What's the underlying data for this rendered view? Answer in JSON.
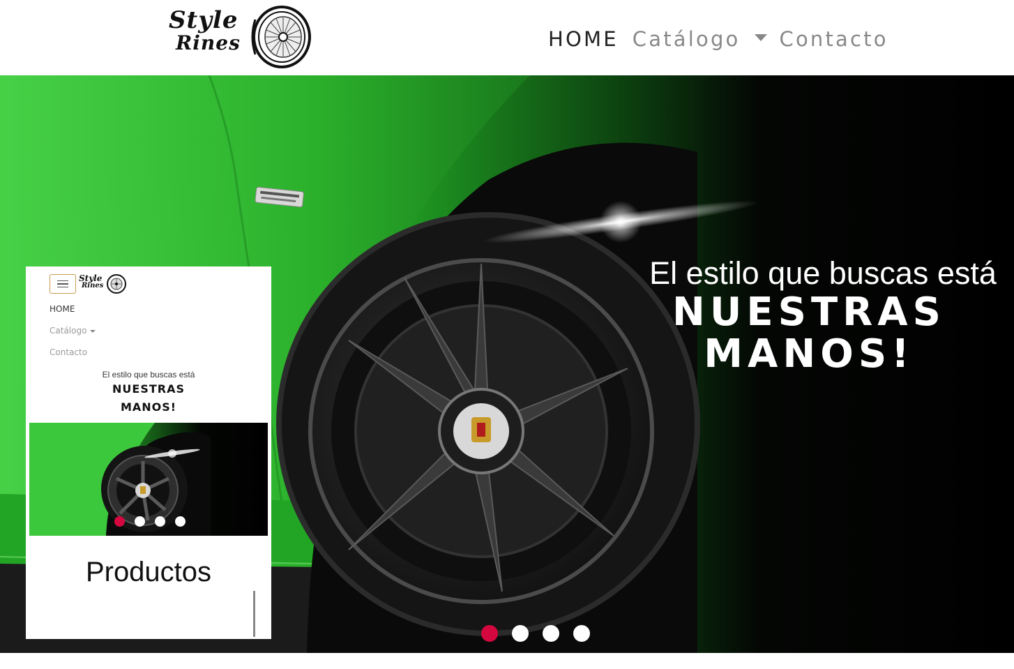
{
  "brand": {
    "logo_line1": "Style",
    "logo_line2": "Rines"
  },
  "nav": {
    "home": "HOME",
    "catalog": "Catálogo",
    "contact": "Contacto"
  },
  "hero": {
    "subtitle": "El estilo que buscas está",
    "title_line1": "NUESTRAS",
    "title_line2": "MANOS!",
    "active_slide": 1,
    "slide_count": 4
  },
  "mobile_preview": {
    "nav": {
      "home": "HOME",
      "catalog": "Catálogo",
      "contact": "Contacto"
    },
    "caption": {
      "subtitle": "El estilo que buscas está",
      "title_line1": "NUESTRAS",
      "title_line2": "MANOS!"
    },
    "products_heading": "Productos",
    "active_slide": 1,
    "slide_count": 4
  },
  "colors": {
    "accent": "#d4083f",
    "car_green": "#2fb82f",
    "nav_text": "#888888",
    "nav_active": "#222222"
  }
}
